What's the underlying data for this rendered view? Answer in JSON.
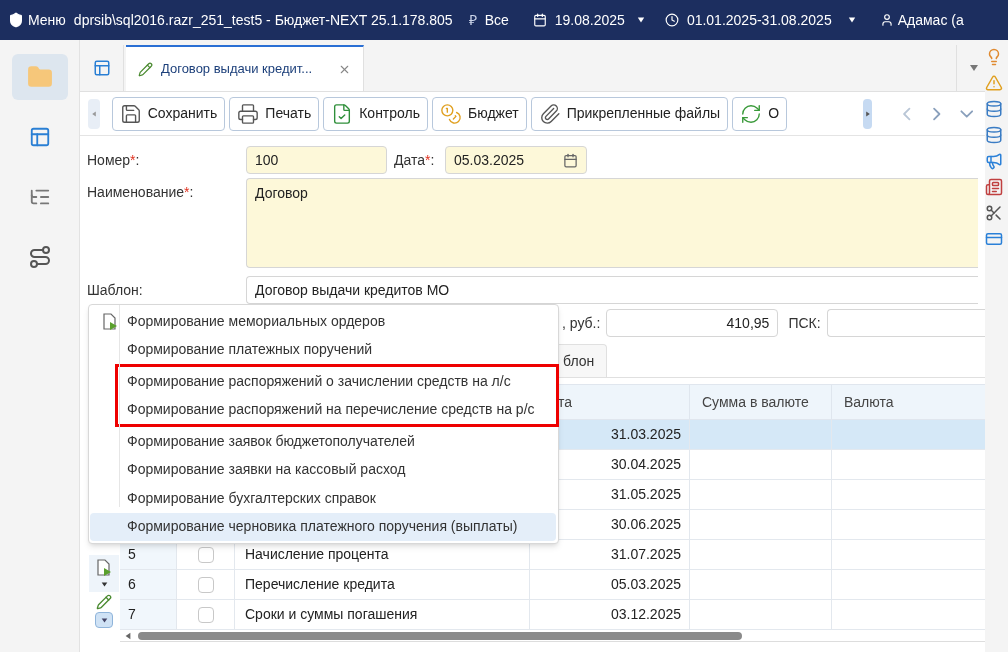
{
  "top_bar": {
    "menu_label": "Меню",
    "title": "dprsib\\sql2016.razr_251_test5 - Бюджет-NEXT 25.1.178.805",
    "currency_symbol": "₽",
    "budget_filter": "Все",
    "date": "19.08.2025",
    "period": "01.01.2025-31.08.2025",
    "user": "Адамас (а"
  },
  "sidebar": {
    "items": [
      {
        "kind": "folder",
        "selected": true
      },
      {
        "kind": "panels",
        "selected": false
      },
      {
        "kind": "tree",
        "selected": false
      },
      {
        "kind": "route",
        "selected": false
      }
    ]
  },
  "tabs": [
    {
      "label": "Договор выдачи кредит...",
      "selected": true
    }
  ],
  "toolbar": {
    "buttons": [
      {
        "kind": "save",
        "label": "Сохранить"
      },
      {
        "kind": "print",
        "label": "Печать"
      },
      {
        "kind": "check",
        "label": "Контроль"
      },
      {
        "kind": "budget",
        "label": "Бюджет"
      },
      {
        "kind": "attach",
        "label": "Прикрепленные файлы"
      },
      {
        "kind": "refresh",
        "label": "О"
      }
    ]
  },
  "form": {
    "fields": [
      {
        "kind": "number",
        "label": "Номер",
        "required_mark": "*",
        "colon": ":",
        "value": "100"
      },
      {
        "kind": "date",
        "label": "Дата",
        "required_mark": "*",
        "colon": ":",
        "value": "05.03.2025"
      },
      {
        "kind": "textarea",
        "label": "Наименование",
        "required_mark": "*",
        "colon": ":",
        "value": "Договор"
      },
      {
        "kind": "template",
        "label": "Шаблон",
        "colon": ":",
        "value": "Договор выдачи кредитов МО"
      }
    ],
    "amount_label": ", руб.:",
    "amount": "410,95",
    "psk_label": "ПСК:"
  },
  "subtabs": [
    {
      "label": "блон",
      "selected": true
    }
  ],
  "table": {
    "columns": [
      "та",
      "Сумма в валюте",
      "Валюта"
    ],
    "rows": [
      {
        "date": "31.03.2025",
        "selected": true
      },
      {
        "date": "30.04.2025",
        "selected": false
      },
      {
        "date": "31.05.2025",
        "selected": false
      },
      {
        "date": "30.06.2025",
        "selected": false
      },
      {
        "number": "5",
        "checked": false,
        "name": "Начисление процента",
        "date": "31.07.2025",
        "selected": false
      },
      {
        "number": "6",
        "checked": false,
        "name": "Перечисление кредита",
        "date": "05.03.2025",
        "selected": false
      },
      {
        "number": "7",
        "checked": false,
        "name": "Сроки и суммы погашения",
        "date": "03.12.2025",
        "selected": false
      }
    ]
  },
  "menu": {
    "items": [
      {
        "label": "Формирование мемориальных ордеров",
        "selected": false,
        "outlined": false
      },
      {
        "label": "Формирование платежных поручений",
        "selected": false,
        "outlined": false
      },
      {
        "label": "Формирование распоряжений о зачислении средств на л/с",
        "selected": false,
        "outlined": true
      },
      {
        "label": "Формирование распоряжений на перечисление средств на р/с",
        "selected": false,
        "outlined": true
      },
      {
        "label": "Формирование заявок бюджетополучателей",
        "selected": false,
        "outlined": false
      },
      {
        "label": "Формирование заявки на кассовый расход",
        "selected": false,
        "outlined": false
      },
      {
        "label": "Формирование бухгалтерских справок",
        "selected": false,
        "outlined": false
      },
      {
        "label": "Формирование черновика платежного поручения (выплаты)",
        "selected": true,
        "outlined": false
      }
    ]
  }
}
